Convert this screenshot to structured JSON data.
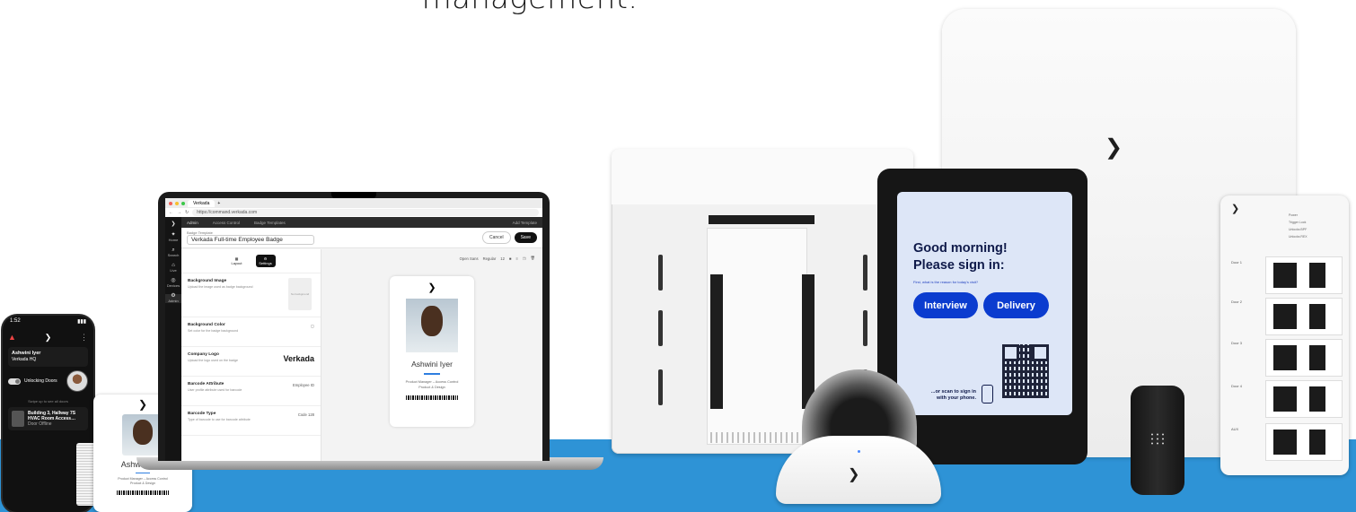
{
  "headline": "management.",
  "phone": {
    "time": "1:52",
    "user_name": "Ashwini Iyer",
    "user_sub": "Verkada HQ",
    "unlock_label": "Unlocking Doors",
    "tip": "Swipe up to see all doors",
    "door_name": "Building 3, Hallway 7S HVAC Room Access…",
    "door_status": "Door Offline"
  },
  "badge": {
    "name": "Ashwini Iyer",
    "subtitle": "Product Manager – Access Control",
    "dept": "Product & Design"
  },
  "browser": {
    "tab_title": "Verkada",
    "url": "https://command.verkada.com"
  },
  "app": {
    "nav": [
      {
        "icon": "✦",
        "label": "Home"
      },
      {
        "icon": "⌕",
        "label": "Search"
      },
      {
        "icon": "⌂",
        "label": "Live"
      },
      {
        "icon": "◎",
        "label": "Devices"
      },
      {
        "icon": "⚙",
        "label": "Admin"
      }
    ],
    "breadcrumb": [
      "Admin",
      "Access Control",
      "Badge Templates"
    ],
    "topbar_right": "Add Template",
    "template_label": "Badge Template",
    "template_name": "Verkada Full-time Employee Badge",
    "cancel_label": "Cancel",
    "save_label": "Save",
    "tabs": [
      {
        "icon": "▦",
        "label": "Layout"
      },
      {
        "icon": "⚙",
        "label": "Settings"
      }
    ],
    "settings": [
      {
        "title": "Background Image",
        "desc": "Upload the image used as badge background"
      },
      {
        "title": "Background Color",
        "desc": "Set color for the badge background"
      },
      {
        "title": "Company Logo",
        "desc": "Upload the logo used on the badge"
      },
      {
        "title": "Barcode Attribute",
        "desc": "User profile attribute used for barcode",
        "value": "Employee ID"
      },
      {
        "title": "Barcode Type",
        "desc": "Type of barcode to use for barcode attribute",
        "value": "Code 128"
      }
    ],
    "bg_placeholder": "No background",
    "logo_word": "Verkada",
    "toolbar": [
      "Open Sans",
      "Regular",
      "12"
    ],
    "preview": {
      "name": "Ashwini Iyer",
      "subtitle": "Product Manager – Access Control",
      "dept": "Product & Design"
    }
  },
  "tablet": {
    "greeting": "Good morning!",
    "prompt": "Please sign in:",
    "reason": "First, what is the reason for today's visit?",
    "buttons": [
      "Interview",
      "Delivery"
    ],
    "scan_text": "...or scan to sign in with your phone."
  },
  "iomodule": {
    "doors": [
      "Door 1",
      "Door 2",
      "Door 3",
      "Door 4",
      "AUX"
    ],
    "leds": [
      "Power",
      "Trigger Lock",
      "Unlocks BPF",
      "Unlocks REX"
    ]
  },
  "colors": {
    "floor": "#2e93d6",
    "accent": "#0b3ccf",
    "tablet_screen": "#dde6f7"
  }
}
